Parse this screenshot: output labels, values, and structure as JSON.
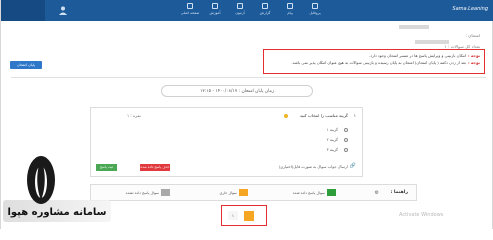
{
  "topbar": {
    "brand": "Sama.Leaning",
    "nav": [
      {
        "label": "صفحه اصلی",
        "icon": "home-icon"
      },
      {
        "label": "آموزش",
        "icon": "book-icon"
      },
      {
        "label": "آزمون",
        "icon": "exam-icon"
      },
      {
        "label": "گزارش",
        "icon": "report-icon"
      },
      {
        "label": "پیام",
        "icon": "message-icon"
      },
      {
        "label": "پروفایل",
        "icon": "profile-icon"
      }
    ]
  },
  "header": {
    "line1_label": "امتحان :",
    "line2_label": "تعداد کل سوالات : ۱"
  },
  "notice": {
    "line1_title": "توجه :",
    "line1_text": "امکان بازبینی و ویرایش پاسخ ها در مسیر امتحان وجود دارد.",
    "line2_title": "توجه :",
    "line2_text": "بعد از زدن دکمه ( پایان امتحان) امتحان به پایان رسیده و بازبینی سوالات به هیچ عنوان امکان پذیر نمی باشد."
  },
  "end_exam_button": "پایان امتحان",
  "end_time": "زمان پایان امتحان : ۱۴۰۰/۰۸/۱۷ - ۱۳:۱۵",
  "question": {
    "number": "۱",
    "title": "گزینه مناسب را انتخاب کنید",
    "score": "نمره : ۱",
    "options": [
      "گزینه ۱",
      "گزینه ۲",
      "گزینه ۳"
    ],
    "upload_label": "ارسال جواب سوال به صورت فایل(اختیاری)",
    "delete_answer_button": "حذف پاسخ داده شده",
    "save_answer_button": "ثبت پاسخ"
  },
  "legend": {
    "title": "راهنما :",
    "items": [
      {
        "label": "سوال پاسخ داده شده",
        "color": "#2e9e3a"
      },
      {
        "label": "سوال جاری",
        "color": "#f5a623"
      },
      {
        "label": "سوال پاسخ داده نشده",
        "color": "#a9a9a9"
      }
    ]
  },
  "question_nav": {
    "item": "۱"
  },
  "watermark": {
    "activate": "Activate Windows",
    "logo_text": "سامانه مشاوره هپوا"
  }
}
